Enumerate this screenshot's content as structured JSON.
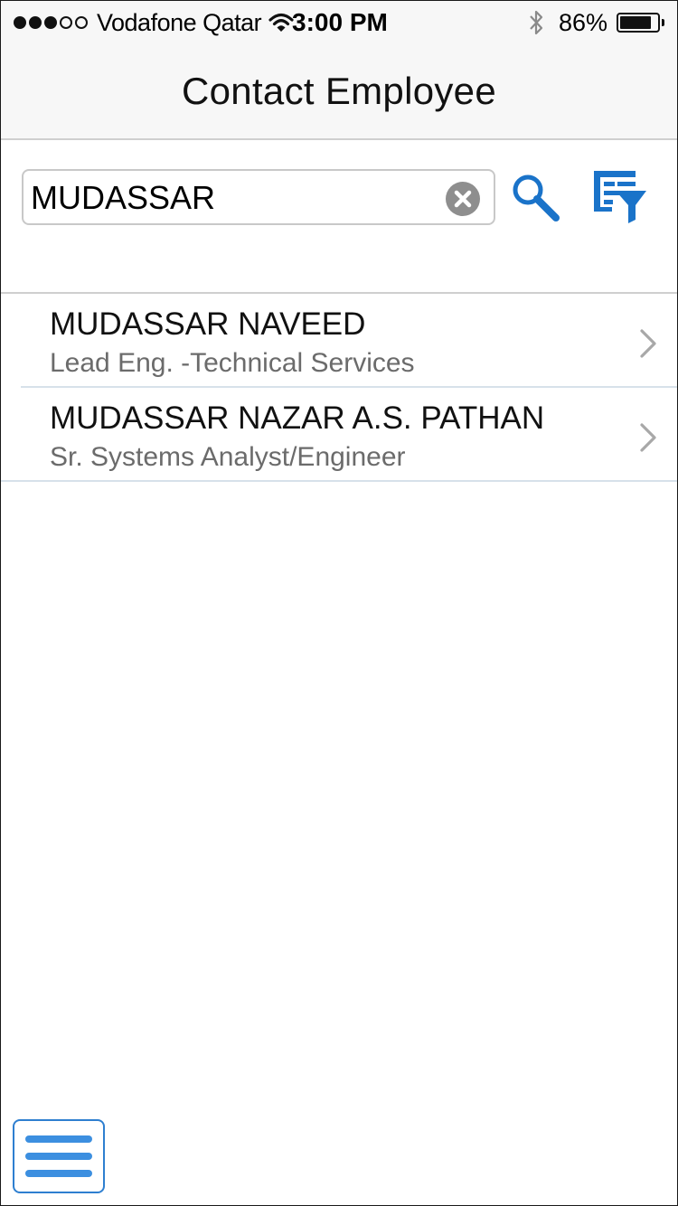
{
  "status_bar": {
    "carrier": "Vodafone Qatar",
    "time": "3:00 PM",
    "battery_percent": "86%",
    "battery_level": 0.86,
    "signal_bars_filled": 3,
    "signal_bars_total": 5
  },
  "header": {
    "title": "Contact Employee"
  },
  "search": {
    "value": "MUDASSAR",
    "clear_icon": "clear-circle-icon",
    "search_icon": "magnifier-icon",
    "filter_icon": "list-filter-icon"
  },
  "results": [
    {
      "name": "MUDASSAR NAVEED",
      "role": "Lead Eng. -Technical Services"
    },
    {
      "name": "MUDASSAR NAZAR A.S. PATHAN",
      "role": "Sr. Systems Analyst/Engineer"
    }
  ],
  "bottom": {
    "menu_icon": "hamburger-menu-icon"
  },
  "colors": {
    "accent": "#1a73c9",
    "menu_accent": "#3c8fe0",
    "secondary_text": "#6b6b6b"
  }
}
